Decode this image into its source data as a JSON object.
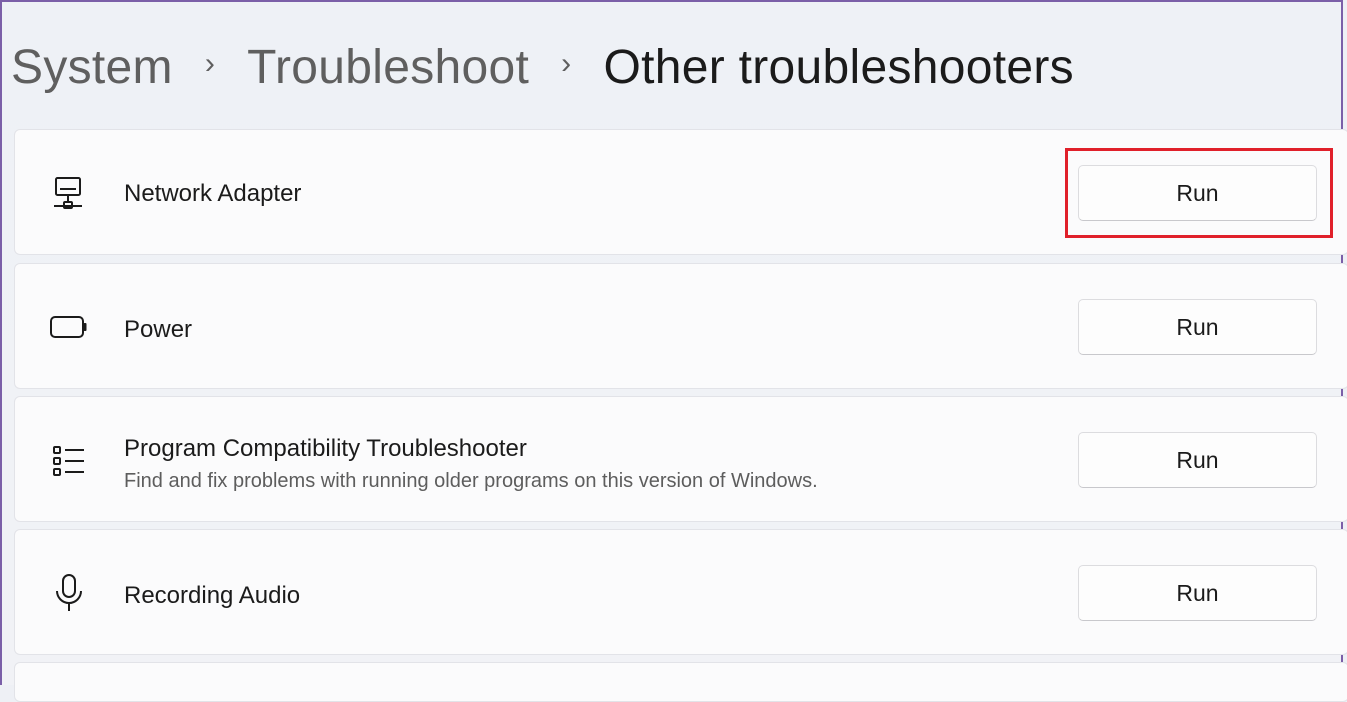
{
  "breadcrumb": {
    "items": [
      "System",
      "Troubleshoot",
      "Other troubleshooters"
    ],
    "separator": "›"
  },
  "troubleshooters": [
    {
      "title": "Network Adapter",
      "description": "",
      "icon": "network-adapter-icon",
      "button_label": "Run",
      "highlighted": true
    },
    {
      "title": "Power",
      "description": "",
      "icon": "battery-icon",
      "button_label": "Run"
    },
    {
      "title": "Program Compatibility Troubleshooter",
      "description": "Find and fix problems with running older programs on this version of Windows.",
      "icon": "list-icon",
      "button_label": "Run"
    },
    {
      "title": "Recording Audio",
      "description": "",
      "icon": "microphone-icon",
      "button_label": "Run"
    }
  ],
  "colors": {
    "highlight": "#e0202a",
    "frame": "#7b5fa8"
  }
}
